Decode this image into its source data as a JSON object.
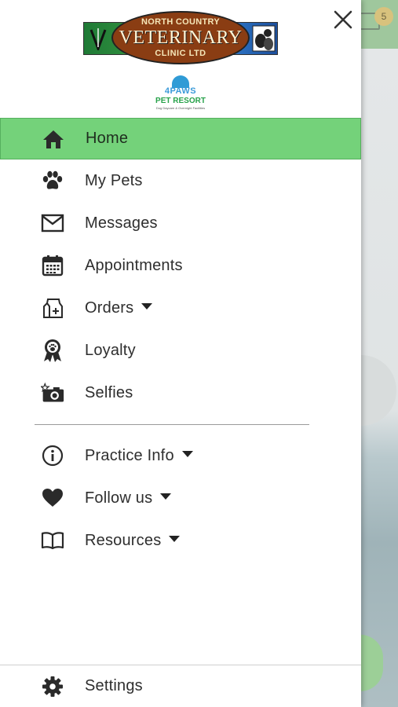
{
  "background": {
    "badge_count": "5"
  },
  "drawer": {
    "close_icon": "close-icon",
    "logo": {
      "line1": "NORTH COUNTRY",
      "line2": "VETERINARY",
      "line3": "CLINIC LTD"
    },
    "sublogo": {
      "line1": "4PAWS",
      "line2": "PET RESORT",
      "line3": "Dog Daycare & Overnight Facilities"
    },
    "primary_items": [
      {
        "label": "Home",
        "icon": "home-icon",
        "active": true
      },
      {
        "label": "My Pets",
        "icon": "paw-icon"
      },
      {
        "label": "Messages",
        "icon": "envelope-icon"
      },
      {
        "label": "Appointments",
        "icon": "calendar-icon"
      },
      {
        "label": "Orders",
        "icon": "food-bag-icon",
        "has_dropdown": true
      },
      {
        "label": "Loyalty",
        "icon": "award-ribbon-icon"
      },
      {
        "label": "Selfies",
        "icon": "camera-icon"
      }
    ],
    "secondary_items": [
      {
        "label": "Practice Info",
        "icon": "info-icon",
        "has_dropdown": true
      },
      {
        "label": "Follow us",
        "icon": "heart-icon",
        "has_dropdown": true
      },
      {
        "label": "Resources",
        "icon": "book-icon",
        "has_dropdown": true
      }
    ],
    "footer": {
      "label": "Settings",
      "icon": "gear-icon"
    }
  },
  "colors": {
    "active_bg": "#74d27a",
    "header_bg": "#9fc79d"
  }
}
